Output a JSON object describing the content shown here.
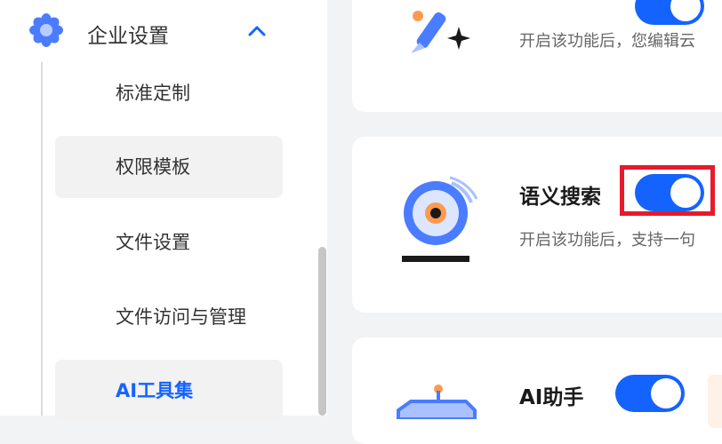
{
  "sidebar": {
    "group": {
      "label": "企业设置",
      "expanded": true
    },
    "items": [
      {
        "label": "标准定制",
        "state": "normal"
      },
      {
        "label": "权限模板",
        "state": "hover"
      },
      {
        "label": "文件设置",
        "state": "normal"
      },
      {
        "label": "文件访问与管理",
        "state": "normal"
      },
      {
        "label": "AI工具集",
        "state": "active"
      }
    ]
  },
  "cards": [
    {
      "title": "",
      "description": "开启该功能后，您编辑云",
      "enabled": true
    },
    {
      "title": "语义搜索",
      "description": "开启该功能后，支持一句",
      "enabled": true
    },
    {
      "title": "AI助手",
      "description": "",
      "enabled": true
    }
  ],
  "colors": {
    "accent": "#1463ff",
    "highlight": "#e8192c",
    "background": "#f2f3f5"
  },
  "icons": {
    "group": "flower-gear-icon",
    "chevron": "chevron-up-icon",
    "card1": "magic-brush-icon",
    "card2": "semantic-search-eye-icon",
    "card3": "ai-assistant-robot-icon"
  }
}
